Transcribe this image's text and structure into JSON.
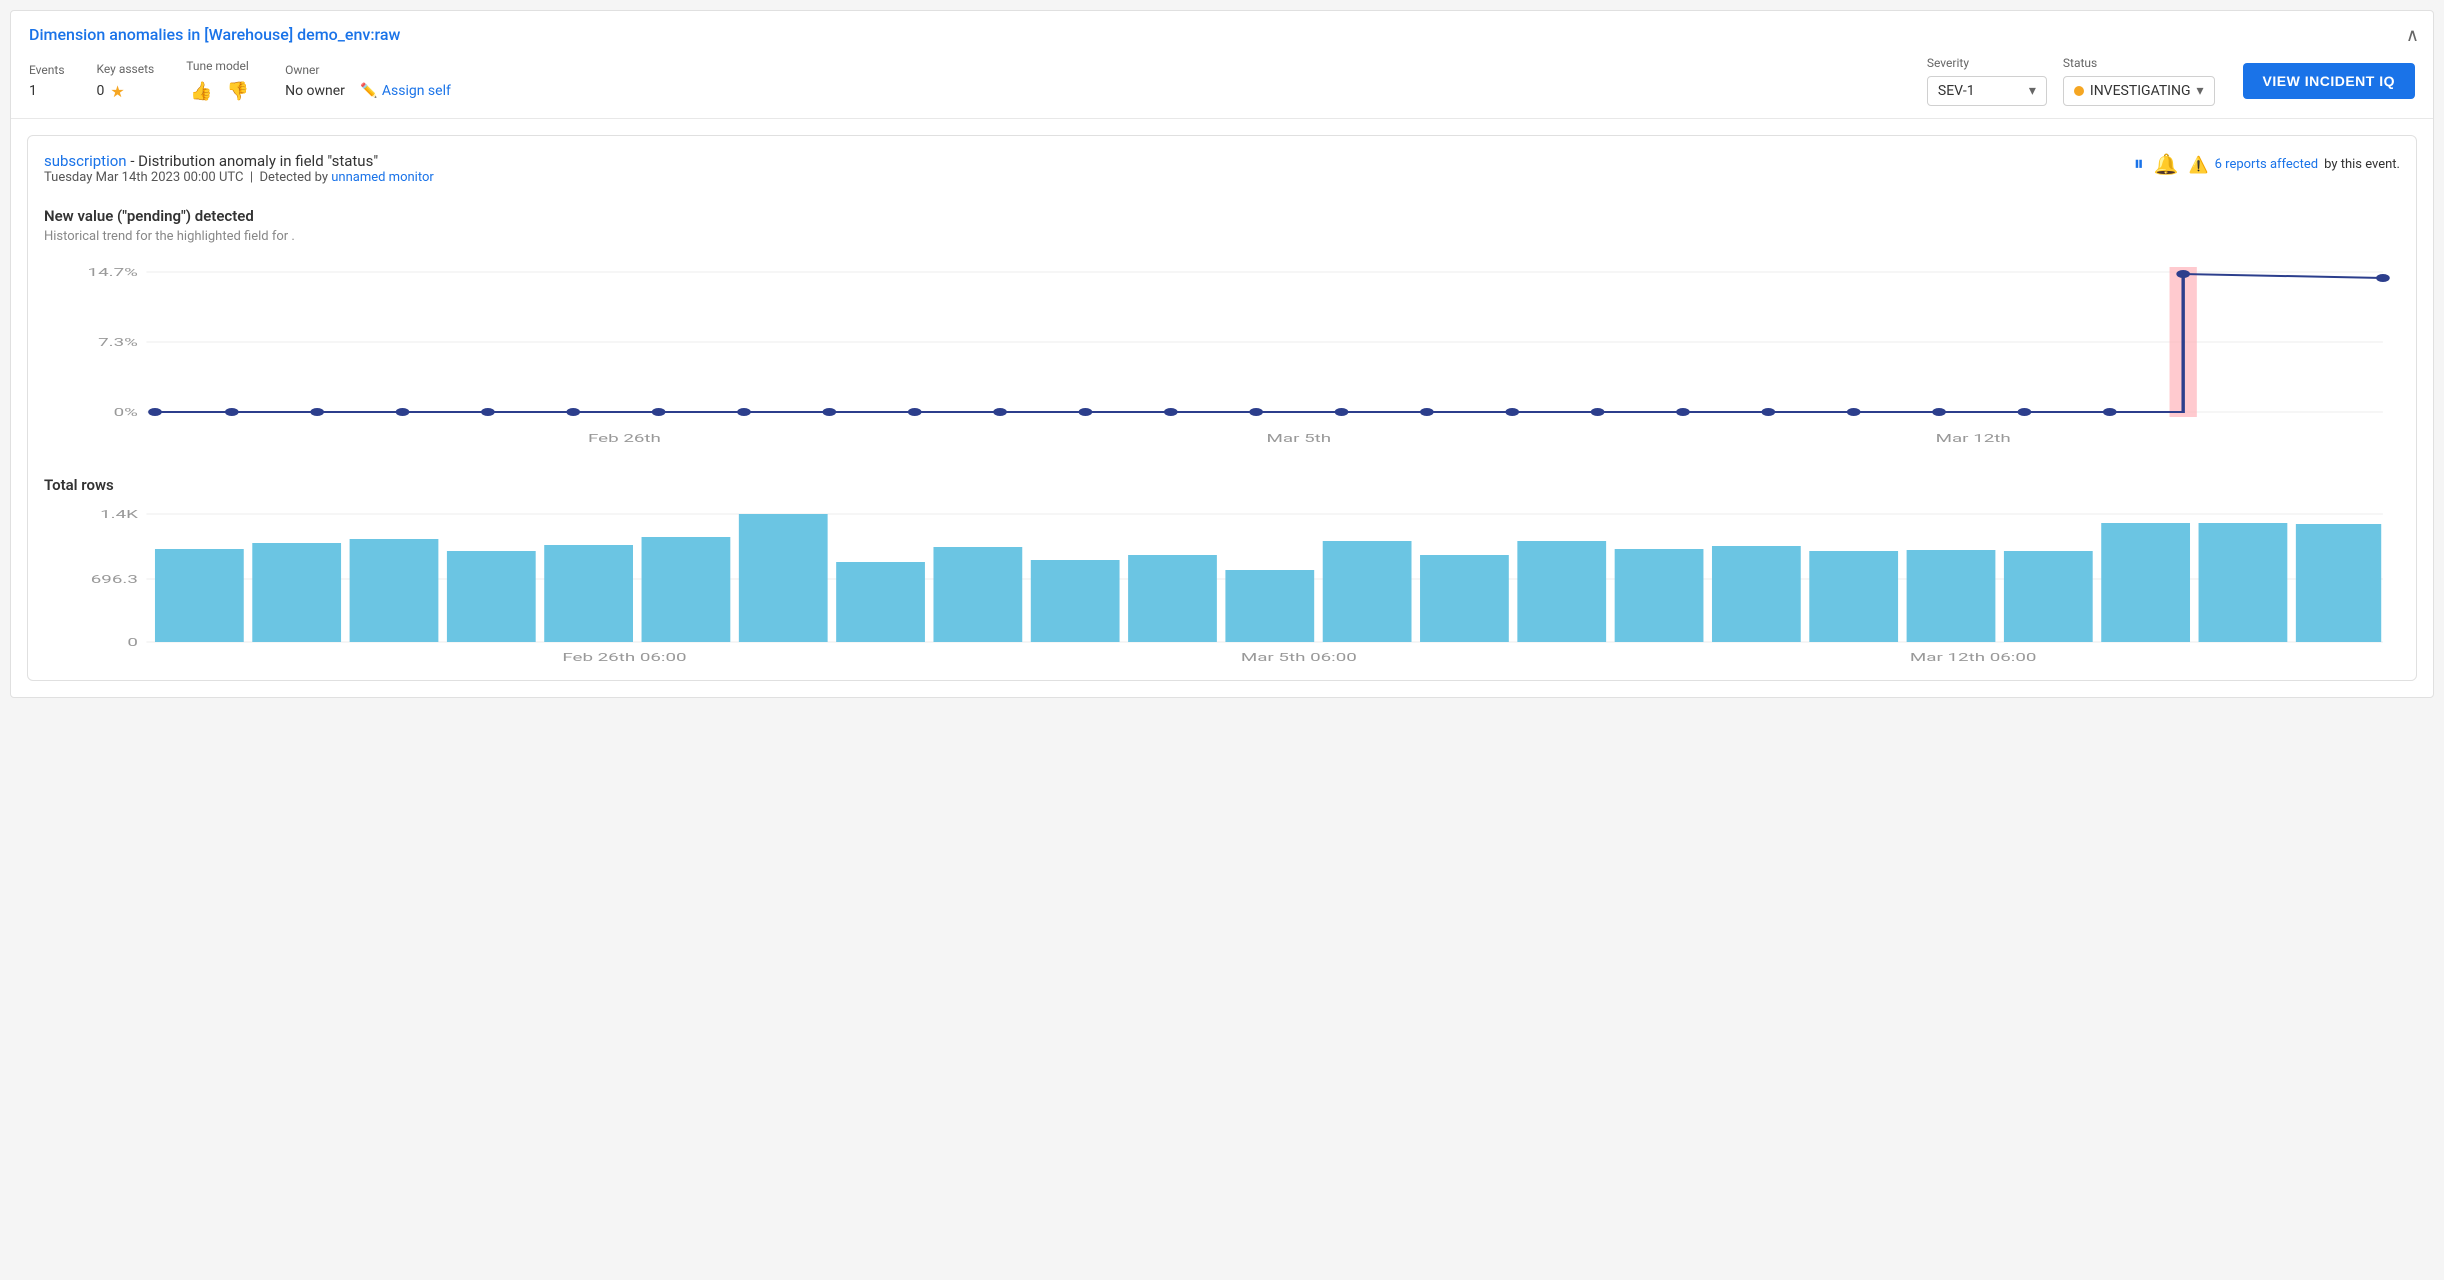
{
  "header": {
    "title": "Dimension anomalies in [Warehouse] demo_env:raw",
    "close_label": "×",
    "meta": {
      "events_label": "Events",
      "events_value": "1",
      "key_assets_label": "Key assets",
      "key_assets_value": "0",
      "tune_model_label": "Tune model",
      "thumb_up": "👍",
      "thumb_down": "👎",
      "owner_label": "Owner",
      "owner_value": "No owner",
      "assign_self_label": "Assign self",
      "severity_label": "Severity",
      "severity_value": "SEV-1",
      "status_label": "Status",
      "status_value": "INVESTIGATING",
      "view_incident_label": "VIEW INCIDENT IQ"
    }
  },
  "event_card": {
    "subscription_link": "subscription",
    "title_suffix": "- Distribution anomaly in field \"status\"",
    "date_text": "Tuesday Mar 14th 2023 00:00 UTC",
    "detected_by_prefix": "Detected by",
    "monitor_link": "unnamed monitor",
    "pause_icon": "⏸",
    "bell_icon": "🔔",
    "warning_icon": "⚠",
    "affected_count": "6",
    "affected_text": "reports affected",
    "affected_suffix": "by this event.",
    "chart": {
      "new_value_title": "New value (\"pending\") detected",
      "subtitle": "Historical trend for the highlighted field for .",
      "y_labels": [
        "14.7%",
        "7.3%",
        "0%"
      ],
      "x_labels": [
        "Feb 26th",
        "Mar 5th",
        "Mar 12th"
      ],
      "anomaly_x_ratio": 0.905
    },
    "bar_chart": {
      "title": "Total rows",
      "y_labels": [
        "1.4K",
        "696.3",
        "0"
      ],
      "x_labels": [
        "Feb 26th 06:00",
        "Mar 5th 06:00",
        "Mar 12th 06:00"
      ],
      "bars": [
        {
          "height": 0.72
        },
        {
          "height": 0.77
        },
        {
          "height": 0.8
        },
        {
          "height": 0.71
        },
        {
          "height": 0.76
        },
        {
          "height": 0.82
        },
        {
          "height": 1.0
        },
        {
          "height": 0.63
        },
        {
          "height": 0.74
        },
        {
          "height": 0.64
        },
        {
          "height": 0.68
        },
        {
          "height": 0.56
        },
        {
          "height": 0.79
        },
        {
          "height": 0.68
        },
        {
          "height": 0.79
        },
        {
          "height": 0.73
        },
        {
          "height": 0.75
        },
        {
          "height": 0.71
        },
        {
          "height": 0.72
        },
        {
          "height": 0.71
        },
        {
          "height": 0.93
        },
        {
          "height": 0.93
        },
        {
          "height": 0.93
        }
      ]
    }
  }
}
